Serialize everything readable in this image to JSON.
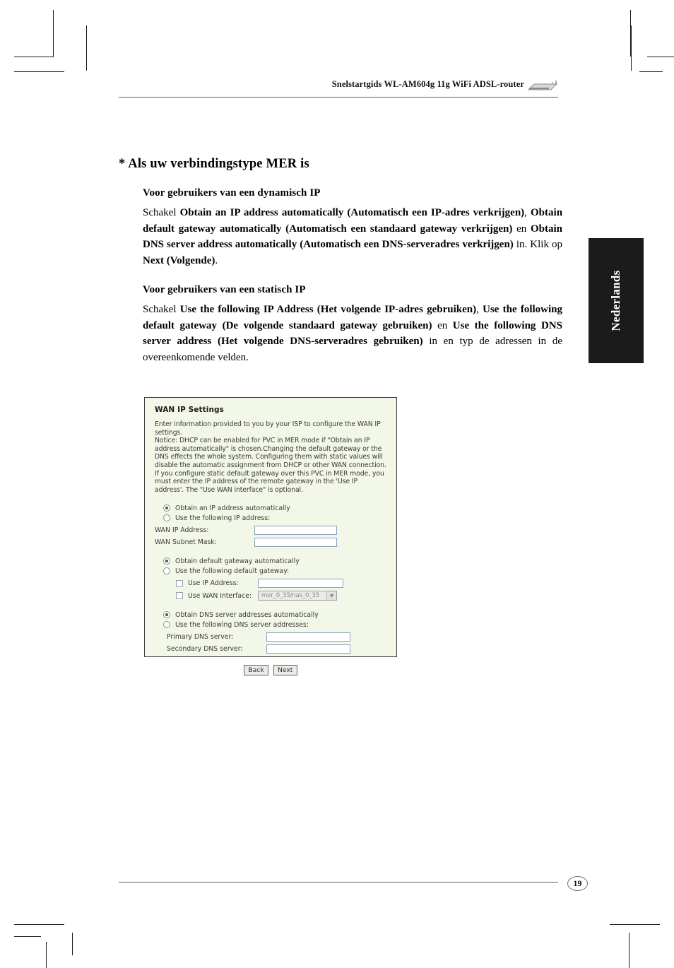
{
  "header": {
    "title": "Snelstartgids WL-AM604g 11g WiFi ADSL-router",
    "device_icon": "router-icon"
  },
  "side_tab": {
    "label": "Nederlands"
  },
  "content": {
    "section_title": "* Als uw verbindingstype MER is",
    "dynamic": {
      "subhead": "Voor gebruikers van een dynamisch IP",
      "text_lead": "Schakel ",
      "bold_1": "Obtain an IP address automatically (Automatisch een IP-adres verkrijgen)",
      "sep_1": ", ",
      "bold_2": "Obtain default gateway automatically (Automatisch een standaard gateway verkrijgen)",
      "sep_2": " en ",
      "bold_3": "Obtain DNS server address automatically (Automatisch een DNS-serveradres verkrijgen)",
      "tail_1": " in. Klik op ",
      "bold_4": "Next (Volgende)",
      "tail_2": "."
    },
    "static": {
      "subhead": "Voor gebruikers van een statisch IP",
      "text_lead": "Schakel ",
      "bold_1": "Use the following IP Address (Het volgende IP-adres gebruiken)",
      "sep_1": ", ",
      "bold_2": "Use the following default gateway (De volgende standaard gateway gebruiken)",
      "sep_2": " en ",
      "bold_3": "Use the following DNS server address (Het volgende DNS-serveradres gebruiken)",
      "tail_1": " in  en typ de adressen in de overeenkomende velden."
    }
  },
  "ui_panel": {
    "title": "WAN IP Settings",
    "description": [
      "Enter information provided to you by your ISP to configure the WAN IP settings.",
      "Notice: DHCP can be enabled for PVC in MER mode if \"Obtain an IP address automatically\" is chosen.Changing the default gateway or the DNS effects the whole system. Configuring them with static values will disable the automatic assignment from DHCP or other WAN connection.",
      "If you configure static default gateway over this PVC in MER mode, you must enter the IP address of the remote gateway in the 'Use IP address'. The \"Use WAN interface\" is optional."
    ],
    "ip_group": {
      "radio_auto": "Obtain an IP address automatically",
      "radio_manual": "Use the following IP address:",
      "label_wan_ip": "WAN IP Address:",
      "value_wan_ip": "",
      "label_wan_mask": "WAN Subnet Mask:",
      "value_wan_mask": ""
    },
    "gateway_group": {
      "radio_auto": "Obtain default gateway automatically",
      "radio_manual": "Use the following default gateway:",
      "check_use_ip": "Use IP Address:",
      "value_use_ip": "",
      "check_use_wan_if": "Use WAN Interface:",
      "select_wan_if": "mer_0_35/nas_0_35"
    },
    "dns_group": {
      "radio_auto": "Obtain DNS server addresses automatically",
      "radio_manual": "Use the following DNS server addresses:",
      "label_primary": "Primary DNS server:",
      "value_primary": "",
      "label_secondary": "Secondary DNS server:",
      "value_secondary": ""
    },
    "buttons": {
      "back": "Back",
      "next": "Next"
    }
  },
  "footer": {
    "page_number": "19"
  },
  "colors": {
    "panel_bg": "#f2f7e7",
    "panel_border": "#3b3b3b",
    "side_tab_bg": "#1b1b1b",
    "input_border": "#8ba3bf",
    "radio_dot": "#2b6e2b"
  }
}
